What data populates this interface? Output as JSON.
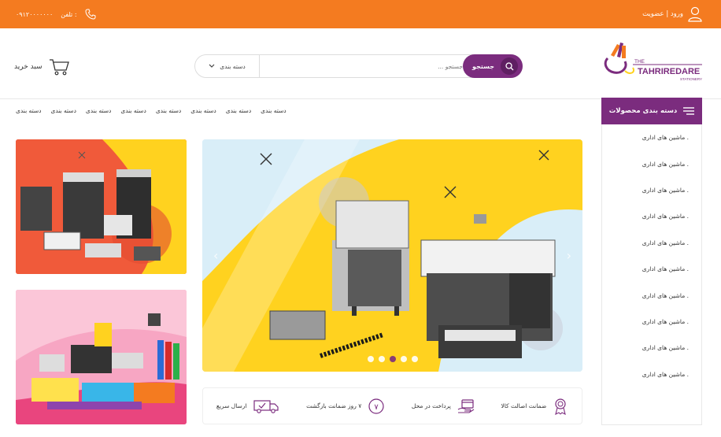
{
  "topbar": {
    "login_label": "ورود | عضویت",
    "phone_label": "تلفن :",
    "phone_number": "۰۹۱۲۰۰۰۰۰۰۰"
  },
  "logo": {
    "line1": "THE",
    "line2": "TAHRIREDARE",
    "line3": "STATIONERY"
  },
  "search": {
    "button_label": "جستجو",
    "placeholder": "جستجو ...",
    "category_label": "دسته بندی"
  },
  "cart": {
    "label": "سبد خرید"
  },
  "nav": {
    "category_button": "دسته بندی محصولات",
    "links": [
      "دسته بندی",
      "دسته بندی",
      "دسته بندی",
      "دسته بندی",
      "دسته بندی",
      "دسته بندی",
      "دسته بندی",
      "دسته بندی"
    ]
  },
  "sidebar": {
    "items": [
      "ماشین های اداری .",
      "ماشین های اداری .",
      "ماشین های اداری .",
      "ماشین های اداری .",
      "ماشین های اداری .",
      "ماشین های اداری .",
      "ماشین های اداری .",
      "ماشین های اداری .",
      "ماشین های اداری .",
      "ماشین های اداری ."
    ]
  },
  "slider": {
    "slide_count": 5,
    "active_index": 2
  },
  "features": [
    {
      "label": "ضمانت اصالت کالا",
      "icon": "award-icon"
    },
    {
      "label": "پرداخت در محل",
      "icon": "payment-icon"
    },
    {
      "label": "۷ روز ضمانت بازگشت",
      "icon": "return-7-icon"
    },
    {
      "label": "ارسال سریع",
      "icon": "truck-icon"
    }
  ],
  "colors": {
    "orange": "#f47b20",
    "purple": "#7b2c7e",
    "yellow": "#ffd21f"
  }
}
